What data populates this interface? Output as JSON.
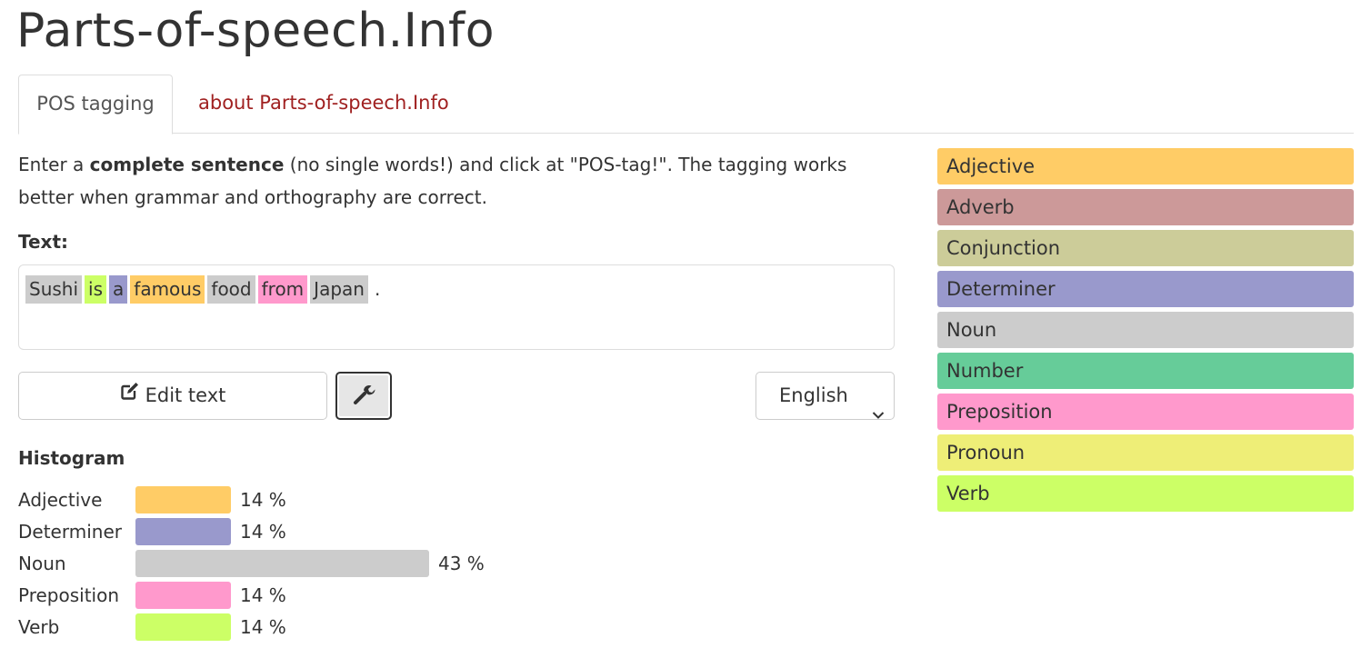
{
  "site": {
    "title": "Parts-of-speech.Info"
  },
  "tabs": [
    {
      "label": "POS tagging"
    },
    {
      "label": "about Parts-of-speech.Info"
    }
  ],
  "intro": {
    "part1": "Enter a ",
    "bold": "complete sentence",
    "part2": " (no single words!) and click at \"POS-tag!\". The tagging works better when grammar and orthography are correct."
  },
  "text_label": "Text:",
  "tokens": [
    {
      "word": "Sushi",
      "tag": "Noun",
      "color": "#cccccc"
    },
    {
      "word": "is",
      "tag": "Verb",
      "color": "#ccff66"
    },
    {
      "word": "a",
      "tag": "Determiner",
      "color": "#9999cc"
    },
    {
      "word": "famous",
      "tag": "Adjective",
      "color": "#ffcc66"
    },
    {
      "word": "food",
      "tag": "Noun",
      "color": "#cccccc"
    },
    {
      "word": "from",
      "tag": "Preposition",
      "color": "#ff99cc"
    },
    {
      "word": "Japan",
      "tag": "Noun",
      "color": "#cccccc"
    },
    {
      "word": ".",
      "tag": "",
      "color": ""
    }
  ],
  "buttons": {
    "edit_label": "Edit text",
    "edit_icon": "edit-icon",
    "tools_icon": "wrench-icon"
  },
  "language": {
    "selected": "English"
  },
  "histogram": {
    "title": "Histogram",
    "rows": [
      {
        "label": "Adjective",
        "percent": 14,
        "text": "14 %",
        "color": "#ffcc66"
      },
      {
        "label": "Determiner",
        "percent": 14,
        "text": "14 %",
        "color": "#9999cc"
      },
      {
        "label": "Noun",
        "percent": 43,
        "text": "43 %",
        "color": "#cccccc"
      },
      {
        "label": "Preposition",
        "percent": 14,
        "text": "14 %",
        "color": "#ff99cc"
      },
      {
        "label": "Verb",
        "percent": 14,
        "text": "14 %",
        "color": "#ccff66"
      }
    ]
  },
  "legend": [
    {
      "label": "Adjective",
      "color": "#ffcc66"
    },
    {
      "label": "Adverb",
      "color": "#cc9999"
    },
    {
      "label": "Conjunction",
      "color": "#cccc99"
    },
    {
      "label": "Determiner",
      "color": "#9999cc"
    },
    {
      "label": "Noun",
      "color": "#cccccc"
    },
    {
      "label": "Number",
      "color": "#66cc99"
    },
    {
      "label": "Preposition",
      "color": "#ff99cc"
    },
    {
      "label": "Pronoun",
      "color": "#eeee77"
    },
    {
      "label": "Verb",
      "color": "#ccff66"
    }
  ]
}
